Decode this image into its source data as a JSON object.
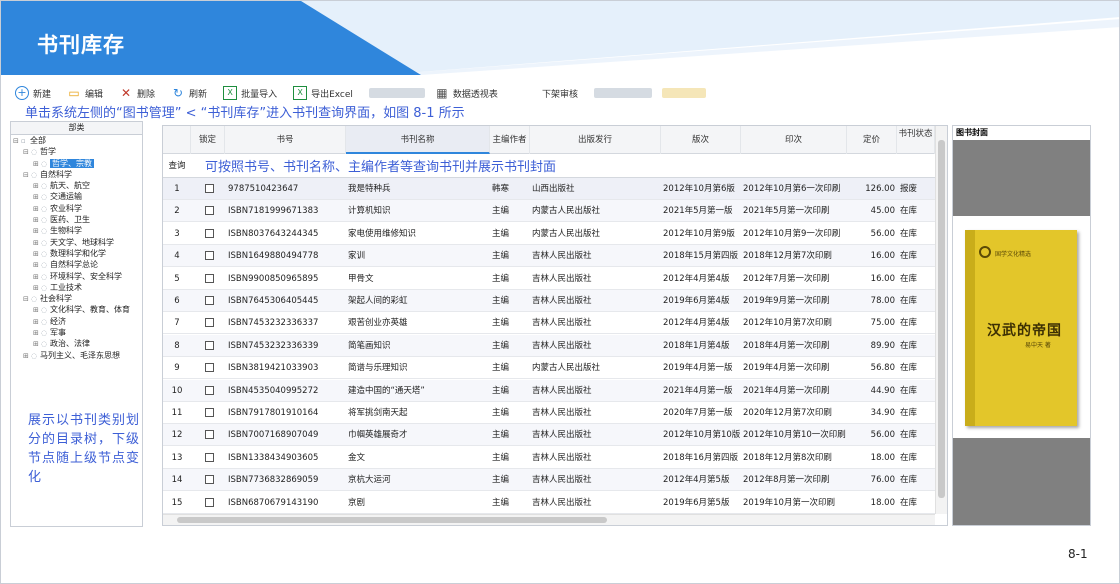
{
  "banner": {
    "title": "书刊库存"
  },
  "toolbar": {
    "new": "新建",
    "edit": "编辑",
    "delete": "删除",
    "refresh": "刷新",
    "batch_import": "批量导入",
    "export_excel": "导出Excel",
    "pivot": "数据透视表",
    "shelf_review": "下架审核"
  },
  "annotations": {
    "top": "单击系统左侧的“图书管理” < “书刊库存”进入书刊查询界面，如图 8-1 所示",
    "grid": "可按照书号、书刊名称、主编作者等查询书刊并展示书刊封面",
    "tree": "展示以书刊类别划分的目录树，下级节点随上级节点变化"
  },
  "tree": {
    "header": "部类",
    "nodes": [
      {
        "label": "全部",
        "level": 0,
        "expander": "⊟"
      },
      {
        "label": "哲学",
        "level": 1,
        "expander": "⊟"
      },
      {
        "label": "哲学、宗教",
        "level": 2,
        "expander": "⊞",
        "selected": true
      },
      {
        "label": "自然科学",
        "level": 1,
        "expander": "⊟"
      },
      {
        "label": "航天、航空",
        "level": 2,
        "expander": "⊞"
      },
      {
        "label": "交通运输",
        "level": 2,
        "expander": "⊞"
      },
      {
        "label": "农业科学",
        "level": 2,
        "expander": "⊞"
      },
      {
        "label": "医药、卫生",
        "level": 2,
        "expander": "⊞"
      },
      {
        "label": "生物科学",
        "level": 2,
        "expander": "⊞"
      },
      {
        "label": "天文学、地球科学",
        "level": 2,
        "expander": "⊞"
      },
      {
        "label": "数理科学和化学",
        "level": 2,
        "expander": "⊞"
      },
      {
        "label": "自然科学总论",
        "level": 2,
        "expander": "⊞"
      },
      {
        "label": "环境科学、安全科学",
        "level": 2,
        "expander": "⊞"
      },
      {
        "label": "工业技术",
        "level": 2,
        "expander": "⊞"
      },
      {
        "label": "社会科学",
        "level": 1,
        "expander": "⊟"
      },
      {
        "label": "文化科学、教育、体育",
        "level": 2,
        "expander": "⊞"
      },
      {
        "label": "经济",
        "level": 2,
        "expander": "⊞"
      },
      {
        "label": "军事",
        "level": 2,
        "expander": "⊞"
      },
      {
        "label": "政治、法律",
        "level": 2,
        "expander": "⊞"
      },
      {
        "label": "马列主义、毛泽东思想",
        "level": 1,
        "expander": "⊞"
      }
    ]
  },
  "grid": {
    "query_label": "查询",
    "columns": [
      "锁定",
      "书号",
      "书刊名称",
      "主编作者",
      "出版发行",
      "版次",
      "印次",
      "定价",
      "书刊状态"
    ],
    "rows": [
      {
        "n": "1",
        "isbn": "9787510423647",
        "title": "我是特种兵",
        "author": "韩寒",
        "publisher": "山西出版社",
        "edition": "2012年10月第6版",
        "printing": "2012年10月第6一次印刷",
        "price": "126.00",
        "status": "报废"
      },
      {
        "n": "2",
        "isbn": "ISBN7181999671383",
        "title": "计算机知识",
        "author": "主编",
        "publisher": "内蒙古人民出版社",
        "edition": "2021年5月第一版",
        "printing": "2021年5月第一次印刷",
        "price": "45.00",
        "status": "在库"
      },
      {
        "n": "3",
        "isbn": "ISBN8037643244345",
        "title": "家电使用维修知识",
        "author": "主编",
        "publisher": "内蒙古人民出版社",
        "edition": "2012年10月第9版",
        "printing": "2012年10月第9一次印刷",
        "price": "56.00",
        "status": "在库"
      },
      {
        "n": "4",
        "isbn": "ISBN1649880494778",
        "title": "家训",
        "author": "主编",
        "publisher": "吉林人民出版社",
        "edition": "2018年15月第四版",
        "printing": "2018年12月第7次印刷",
        "price": "16.00",
        "status": "在库"
      },
      {
        "n": "5",
        "isbn": "ISBN9900850965895",
        "title": "甲骨文",
        "author": "主编",
        "publisher": "吉林人民出版社",
        "edition": "2012年4月第4版",
        "printing": "2012年7月第一次印刷",
        "price": "16.00",
        "status": "在库"
      },
      {
        "n": "6",
        "isbn": "ISBN7645306405445",
        "title": "架起人间的彩虹",
        "author": "主编",
        "publisher": "吉林人民出版社",
        "edition": "2019年6月第4版",
        "printing": "2019年9月第一次印刷",
        "price": "78.00",
        "status": "在库"
      },
      {
        "n": "7",
        "isbn": "ISBN7453232336337",
        "title": "艰苦创业亦英雄",
        "author": "主编",
        "publisher": "吉林人民出版社",
        "edition": "2012年4月第4版",
        "printing": "2012年10月第7次印刷",
        "price": "75.00",
        "status": "在库"
      },
      {
        "n": "8",
        "isbn": "ISBN7453232336339",
        "title": "简笔画知识",
        "author": "主编",
        "publisher": "吉林人民出版社",
        "edition": "2018年1月第4版",
        "printing": "2018年4月第一次印刷",
        "price": "89.90",
        "status": "在库"
      },
      {
        "n": "9",
        "isbn": "ISBN3819421033903",
        "title": "简谱与乐理知识",
        "author": "主编",
        "publisher": "内蒙古人民出版社",
        "edition": "2019年4月第一版",
        "printing": "2019年4月第一次印刷",
        "price": "56.80",
        "status": "在库"
      },
      {
        "n": "10",
        "isbn": "ISBN4535040995272",
        "title": "建造中国的“通天塔”",
        "author": "主编",
        "publisher": "吉林人民出版社",
        "edition": "2021年4月第一版",
        "printing": "2021年4月第一次印刷",
        "price": "44.90",
        "status": "在库"
      },
      {
        "n": "11",
        "isbn": "ISBN7917801910164",
        "title": "将军挑剑南天起",
        "author": "主编",
        "publisher": "吉林人民出版社",
        "edition": "2020年7月第一版",
        "printing": "2020年12月第7次印刷",
        "price": "34.90",
        "status": "在库"
      },
      {
        "n": "12",
        "isbn": "ISBN7007168907049",
        "title": "巾帼英雄展奇才",
        "author": "主编",
        "publisher": "吉林人民出版社",
        "edition": "2012年10月第10版",
        "printing": "2012年10月第10一次印刷",
        "price": "56.00",
        "status": "在库"
      },
      {
        "n": "13",
        "isbn": "ISBN1338434903605",
        "title": "金文",
        "author": "主编",
        "publisher": "吉林人民出版社",
        "edition": "2018年16月第四版",
        "printing": "2018年12月第8次印刷",
        "price": "18.00",
        "status": "在库"
      },
      {
        "n": "14",
        "isbn": "ISBN7736832869059",
        "title": "京杭大运河",
        "author": "主编",
        "publisher": "吉林人民出版社",
        "edition": "2012年4月第5版",
        "printing": "2012年8月第一次印刷",
        "price": "76.00",
        "status": "在库"
      },
      {
        "n": "15",
        "isbn": "ISBN6870679143190",
        "title": "京剧",
        "author": "主编",
        "publisher": "吉林人民出版社",
        "edition": "2019年6月第5版",
        "printing": "2019年10月第一次印刷",
        "price": "18.00",
        "status": "在库"
      }
    ]
  },
  "cover": {
    "header": "图书封面",
    "book_title": "汉武的帝国",
    "book_brand": "国学文化精选",
    "book_author": "易中天 著"
  },
  "footer": {
    "page_number": "8-1"
  },
  "colors": {
    "accent": "#2f86dc",
    "annotation": "#3d5fd6"
  }
}
